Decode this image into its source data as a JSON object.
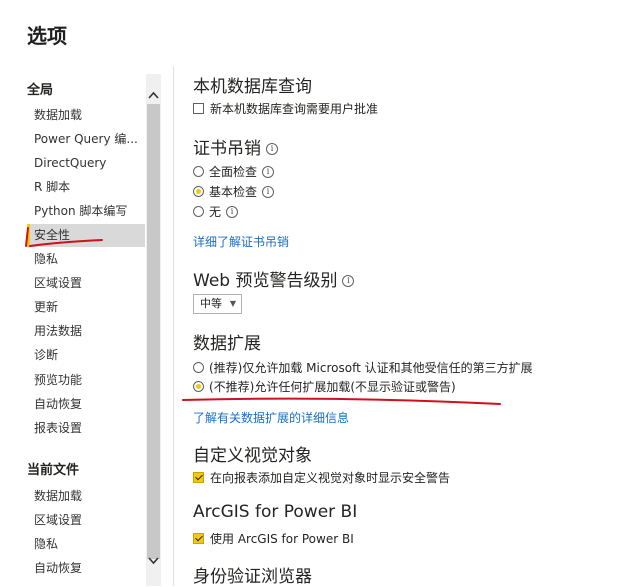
{
  "dialog": {
    "title": "选项"
  },
  "nav": {
    "global_header": "全局",
    "global_items": [
      "数据加载",
      "Power Query 编...",
      "DirectQuery",
      "R 脚本",
      "Python 脚本编写",
      "安全性",
      "隐私",
      "区域设置",
      "更新",
      "用法数据",
      "诊断",
      "预览功能",
      "自动恢复",
      "报表设置"
    ],
    "selected_index": 5,
    "current_header": "当前文件",
    "current_items": [
      "数据加载",
      "区域设置",
      "隐私",
      "自动恢复"
    ]
  },
  "content": {
    "native_db": {
      "heading": "本机数据库查询",
      "checkbox_label": "新本机数据库查询需要用户批准",
      "checked": false
    },
    "cert": {
      "heading": "证书吊销",
      "options": [
        "全面检查",
        "基本检查",
        "无"
      ],
      "selected_index": 1,
      "link": "详细了解证书吊销"
    },
    "web_preview": {
      "heading": "Web 预览警告级别",
      "select_value": "中等"
    },
    "extensions": {
      "heading": "数据扩展",
      "options": [
        "(推荐)仅允许加载 Microsoft 认证和其他受信任的第三方扩展",
        "(不推荐)允许任何扩展加载(不显示验证或警告)"
      ],
      "selected_index": 1,
      "link": "了解有关数据扩展的详细信息"
    },
    "custom_visuals": {
      "heading": "自定义视觉对象",
      "checkbox_label": "在向报表添加自定义视觉对象时显示安全警告",
      "checked": true
    },
    "arcgis": {
      "heading": "ArcGIS for Power BI",
      "checkbox_label": "使用 ArcGIS for Power BI",
      "checked": true
    },
    "auth_browser": {
      "heading": "身份验证浏览器"
    }
  },
  "colors": {
    "accent": "#f2c811",
    "link": "#1a6ec8",
    "annotation": "#d0101a",
    "selected_bg": "#d9d9d9"
  }
}
